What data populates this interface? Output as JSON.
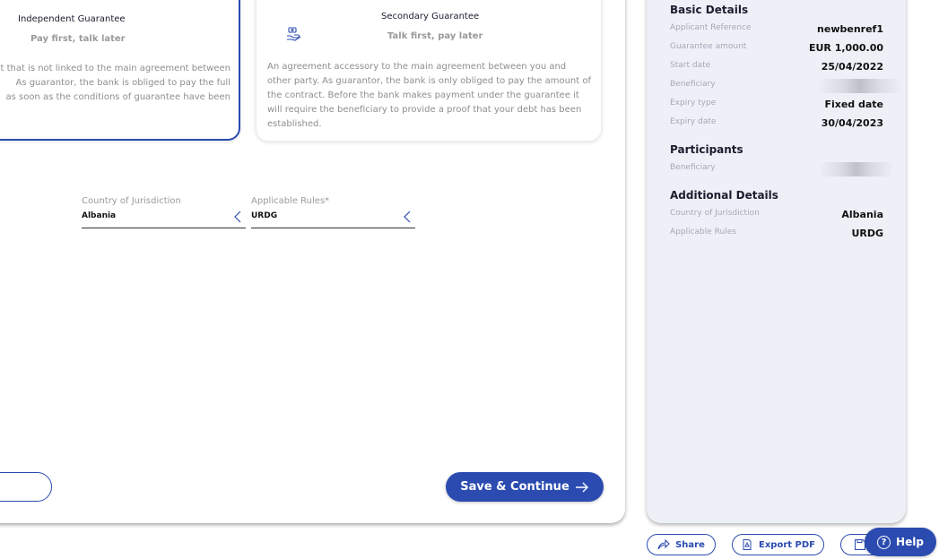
{
  "cards": {
    "independent": {
      "title": "Independent Guarantee",
      "subtitle": "Pay first, talk later",
      "description": "nt that is not linked to the main agreement between\n As guarantor, the bank is obliged to pay the full\nas soon as the conditions of guarantee have been"
    },
    "secondary": {
      "title": "Secondary Guarantee",
      "subtitle": "Talk first, pay later",
      "description": "An agreement accessory to the main agreement between you and other party. As guarantor, the bank is only obliged to pay the amount of the contract. Before the bank makes payment under the guarantee it will require the beneficiary to provide a proof that your debt has been established.",
      "icon": "hand-coins-icon"
    }
  },
  "form": {
    "country": {
      "label": "Country of Jurisdiction",
      "value": "Albania"
    },
    "rules": {
      "label": "Applicable Rules*",
      "value": "URDG"
    }
  },
  "buttons": {
    "save_continue": "Save & Continue",
    "share": "Share",
    "export_pdf": "Export PDF",
    "help": "Help"
  },
  "summary": {
    "basic": {
      "heading": "Basic Details",
      "applicant_reference_label": "Applicant Reference",
      "applicant_reference_value": "newbenref1",
      "guarantee_amount_label": "Guarantee amount",
      "guarantee_amount_value": "EUR 1,000.00",
      "start_date_label": "Start date",
      "start_date_value": "25/04/2022",
      "beneficiary_label": "Beneficiary",
      "expiry_type_label": "Expiry type",
      "expiry_type_value": "Fixed date",
      "expiry_date_label": "Expiry date",
      "expiry_date_value": "30/04/2023"
    },
    "participants": {
      "heading": "Participants",
      "beneficiary_label": "Beneficiary"
    },
    "additional": {
      "heading": "Additional Details",
      "country_label": "Country of Jurisdiction",
      "country_value": "Albania",
      "rules_label": "Applicable Rules",
      "rules_value": "URDG"
    }
  },
  "colors": {
    "accent": "#2b4bb0",
    "summary_bg": "#eef0f8"
  }
}
